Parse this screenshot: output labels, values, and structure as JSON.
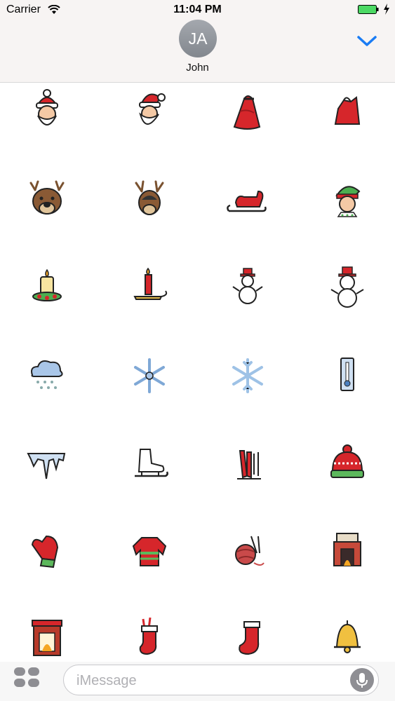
{
  "status_bar": {
    "carrier": "Carrier",
    "time": "11:04 PM",
    "icons": [
      "wifi-icon",
      "battery-icon",
      "charging-bolt-icon"
    ]
  },
  "header": {
    "avatar_initials": "JA",
    "contact_name": "John",
    "collapse_icon": "chevron-down-icon",
    "accent_color": "#1a7cf4"
  },
  "sticker_grid": {
    "columns": 4,
    "stickers": [
      "santa-face",
      "santa-face-beard",
      "red-gift-sack",
      "red-bag",
      "reindeer-face",
      "reindeer-face-alt",
      "sleigh",
      "elf-face",
      "christmas-candle",
      "candle-holder",
      "snowman-small",
      "snowman-top-hat",
      "snow-cloud",
      "snowflake-blue",
      "snowflake-light",
      "thermometer",
      "icicle",
      "ice-skate",
      "skis",
      "winter-hat",
      "mitten",
      "ugly-sweater",
      "yarn-ball",
      "fireplace-lit",
      "fireplace-red",
      "stocking-candy",
      "stocking-red",
      "golden-bell"
    ]
  },
  "message_bar": {
    "placeholder": "iMessage",
    "apps_icon": "app-drawer-icon",
    "mic_icon": "microphone-icon"
  }
}
